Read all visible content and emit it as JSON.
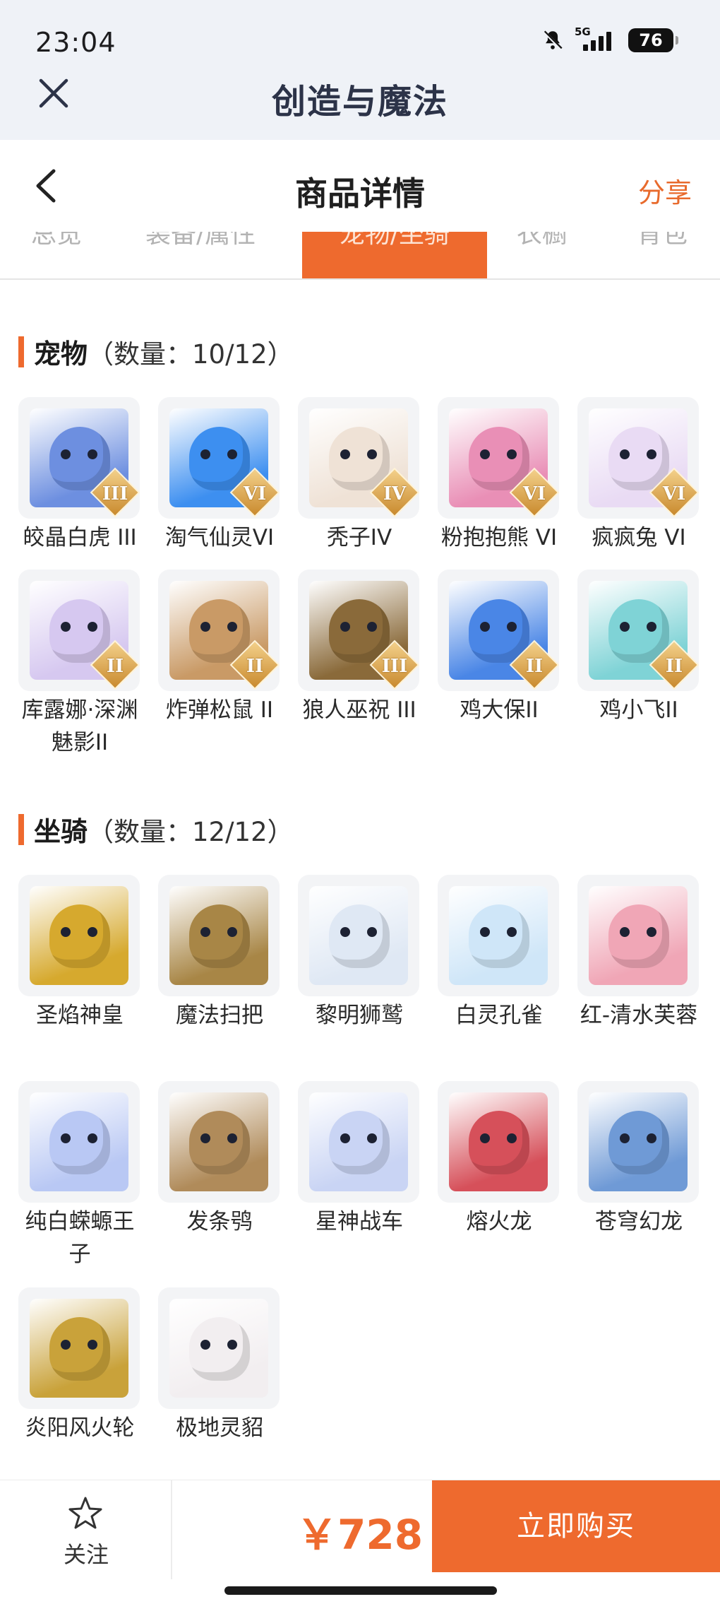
{
  "status_bar": {
    "time": "23:04",
    "network": "5G",
    "battery": "76"
  },
  "app": {
    "title": "创造与魔法"
  },
  "header": {
    "title": "商品详情",
    "share": "分享"
  },
  "tabs": [
    {
      "label": "总览",
      "active": false
    },
    {
      "label": "装备/属性",
      "active": false
    },
    {
      "label": "宠物/坐骑",
      "active": true
    },
    {
      "label": "衣橱",
      "active": false
    },
    {
      "label": "背包",
      "active": false
    }
  ],
  "pets": {
    "title": "宠物",
    "count": "（数量：10/12）",
    "items": [
      {
        "name": "皎晶白虎 III",
        "rank": "III",
        "color": "#6d8fe0"
      },
      {
        "name": "淘气仙灵VI",
        "rank": "VI",
        "color": "#3d8ff0"
      },
      {
        "name": "秃子IV",
        "rank": "IV",
        "color": "#efe2d6"
      },
      {
        "name": "粉抱抱熊 VI",
        "rank": "VI",
        "color": "#e98fb6"
      },
      {
        "name": "疯疯兔 VI",
        "rank": "VI",
        "color": "#e9dbf4"
      },
      {
        "name": "库露娜·深渊魅影II",
        "rank": "II",
        "color": "#d6c8f0"
      },
      {
        "name": "炸弹松鼠 II",
        "rank": "II",
        "color": "#c99a66"
      },
      {
        "name": "狼人巫祝 III",
        "rank": "III",
        "color": "#8a6a3a"
      },
      {
        "name": "鸡大保II",
        "rank": "II",
        "color": "#4a86e6"
      },
      {
        "name": "鸡小飞II",
        "rank": "II",
        "color": "#7fd3d6"
      }
    ]
  },
  "mounts": {
    "title": "坐骑",
    "count": "（数量：12/12）",
    "items": [
      {
        "name": "圣焰神皇",
        "color": "#d6a92e"
      },
      {
        "name": "魔法扫把",
        "color": "#a88646"
      },
      {
        "name": "黎明狮鹫",
        "color": "#dfe8f4"
      },
      {
        "name": "白灵孔雀",
        "color": "#cfe6f8"
      },
      {
        "name": "红-清水芙蓉",
        "color": "#f0a6b6"
      },
      {
        "name": "纯白蝾螈王子",
        "color": "#b9c8f4"
      },
      {
        "name": "发条鸮",
        "color": "#b08b5a"
      },
      {
        "name": "星神战车",
        "color": "#c9d4f4"
      },
      {
        "name": "熔火龙",
        "color": "#d6505a"
      },
      {
        "name": "苍穹幻龙",
        "color": "#6f9ad6"
      },
      {
        "name": "炎阳风火轮",
        "color": "#c9a23a"
      },
      {
        "name": "极地灵貂",
        "color": "#f2eef0"
      }
    ]
  },
  "bottom": {
    "follow": "关注",
    "price": "￥728",
    "buy": "立即购买"
  },
  "colors": {
    "accent": "#ee6a2e"
  }
}
